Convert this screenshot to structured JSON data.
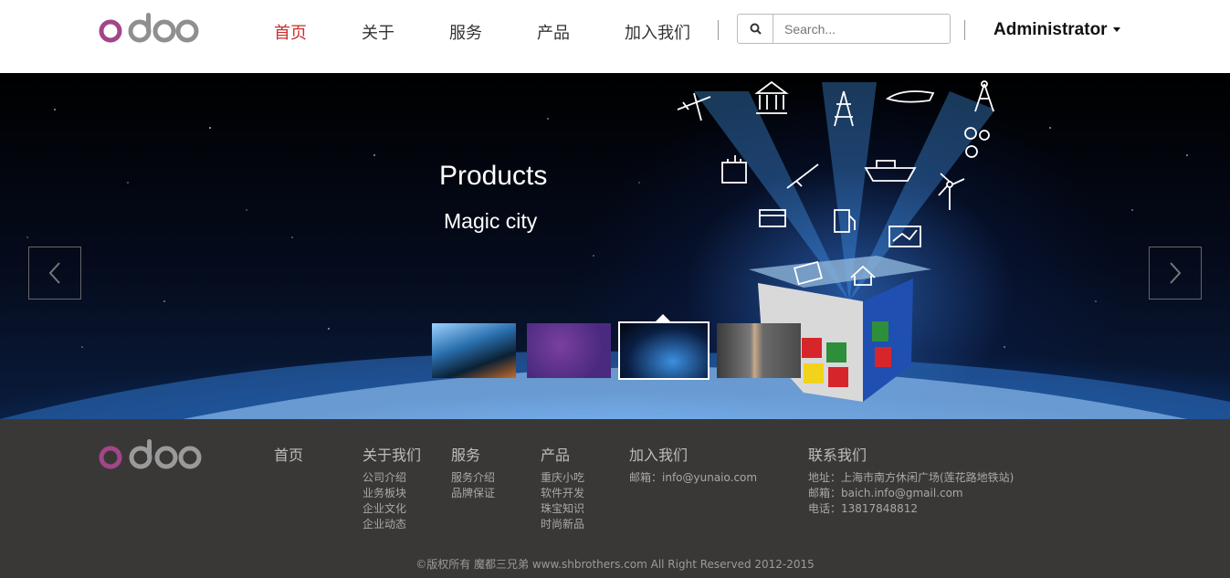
{
  "header": {
    "logo_text": "odoo",
    "nav": [
      "首页",
      "关于",
      "服务",
      "产品",
      "加入我们"
    ],
    "active_index": 0,
    "search": {
      "placeholder": "Search..."
    },
    "user": "Administrator"
  },
  "hero": {
    "title": "Products",
    "subtitle": "Magic city",
    "thumbnails": [
      {
        "name": "light-streaks",
        "selected": false
      },
      {
        "name": "purple-texture",
        "selected": false
      },
      {
        "name": "magic-city",
        "selected": true
      },
      {
        "name": "phone-product",
        "selected": false
      }
    ]
  },
  "footer": {
    "logo_text": "odoo",
    "columns": [
      {
        "heading": "首页",
        "items": []
      },
      {
        "heading": "关于我们",
        "items": [
          "公司介绍",
          "业务板块",
          "企业文化",
          "企业动态"
        ]
      },
      {
        "heading": "服务",
        "items": [
          "服务介绍",
          "品牌保证"
        ]
      },
      {
        "heading": "产品",
        "items": [
          "重庆小吃",
          "软件开发",
          "珠宝知识",
          "时尚新品"
        ]
      },
      {
        "heading": "加入我们",
        "items": [
          "邮箱：info@yunaio.com"
        ]
      },
      {
        "heading": "联系我们",
        "items": [
          "地址：上海市南方休闲广场(莲花路地铁站)",
          "邮箱：baich.info@gmail.com",
          "电话：13817848812"
        ]
      }
    ],
    "copyright": "©版权所有 魔都三兄弟 www.shbrothers.com All Right Reserved 2012-2015"
  },
  "colors": {
    "accent": "#c9302c",
    "logo_purple": "#a24689",
    "logo_gray": "#8f8f8f",
    "footer_bg": "#3a3836"
  }
}
